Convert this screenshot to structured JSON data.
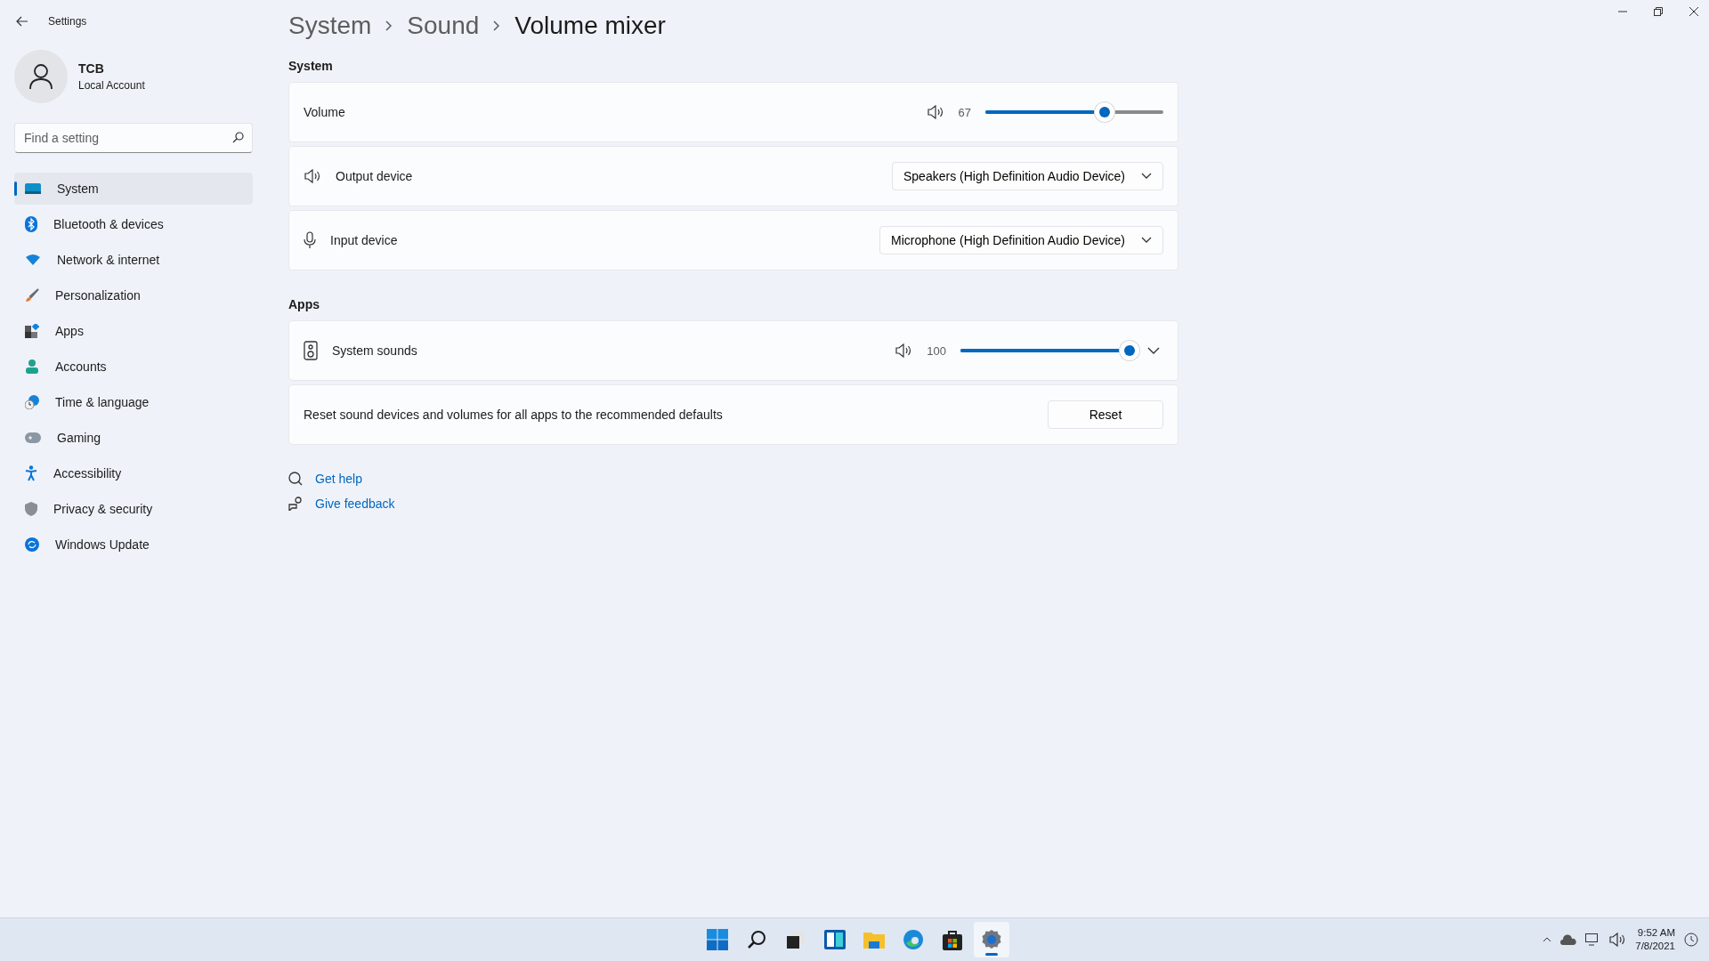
{
  "window": {
    "title": "Settings"
  },
  "user": {
    "name": "TCB",
    "account": "Local Account"
  },
  "search": {
    "placeholder": "Find a setting"
  },
  "nav": [
    {
      "label": "System",
      "kind": "system",
      "selected": true
    },
    {
      "label": "Bluetooth & devices",
      "kind": "bluetooth",
      "selected": false
    },
    {
      "label": "Network & internet",
      "kind": "network",
      "selected": false
    },
    {
      "label": "Personalization",
      "kind": "brush",
      "selected": false
    },
    {
      "label": "Apps",
      "kind": "apps",
      "selected": false
    },
    {
      "label": "Accounts",
      "kind": "accounts",
      "selected": false
    },
    {
      "label": "Time & language",
      "kind": "time",
      "selected": false
    },
    {
      "label": "Gaming",
      "kind": "gaming",
      "selected": false
    },
    {
      "label": "Accessibility",
      "kind": "accessibility",
      "selected": false
    },
    {
      "label": "Privacy & security",
      "kind": "privacy",
      "selected": false
    },
    {
      "label": "Windows Update",
      "kind": "update",
      "selected": false
    }
  ],
  "breadcrumb": [
    "System",
    "Sound",
    "Volume mixer"
  ],
  "sections": [
    {
      "title": "System",
      "rows": [
        {
          "kind": "slider",
          "label": "Volume",
          "reading": "67",
          "level": 0.67
        },
        {
          "kind": "output-device",
          "label": "Output device",
          "value": "Speakers (High Definition Audio Device)"
        },
        {
          "kind": "input-device",
          "label": "Input device",
          "value": "Microphone (High Definition Audio Device)"
        }
      ]
    },
    {
      "title": "Apps",
      "rows": [
        {
          "kind": "app",
          "label": "System sounds",
          "reading": "100",
          "level": 1.0,
          "expanded": false
        },
        {
          "kind": "button",
          "label": "Reset sound devices and volumes for all apps to the recommended defaults",
          "button": "Reset"
        }
      ]
    }
  ],
  "links": [
    {
      "label": "Get help",
      "kind": "help"
    },
    {
      "label": "Give feedback",
      "kind": "feedback"
    }
  ],
  "taskbar": [
    {
      "kind": "start",
      "selected": false
    },
    {
      "kind": "search",
      "selected": false
    },
    {
      "kind": "taskview",
      "selected": false
    },
    {
      "kind": "widgets",
      "selected": false
    },
    {
      "kind": "explorer",
      "selected": false
    },
    {
      "kind": "edge",
      "selected": false
    },
    {
      "kind": "store",
      "selected": false
    },
    {
      "kind": "settings",
      "selected": true
    }
  ],
  "tray": {
    "time": "9:52 AM",
    "date": "7/8/2021"
  }
}
